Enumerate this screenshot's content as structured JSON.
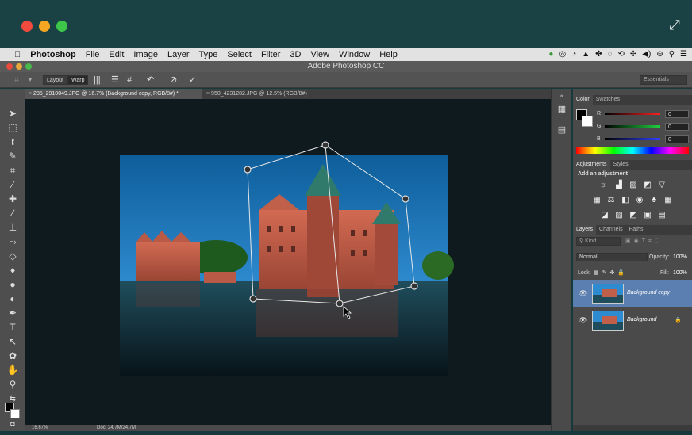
{
  "mac": {
    "app_name": "Photoshop",
    "menus": [
      "File",
      "Edit",
      "Image",
      "Layer",
      "Type",
      "Select",
      "Filter",
      "3D",
      "View",
      "Window",
      "Help"
    ],
    "status_icons": [
      "evernote-icon",
      "creative-cloud-icon",
      "time-icon",
      "bell-icon",
      "puzzle-icon",
      "wifi-icon",
      "history-icon",
      "bluetooth-icon",
      "volume-icon",
      "clock-icon",
      "search-icon",
      "list-icon"
    ]
  },
  "window": {
    "title": "Adobe Photoshop CC"
  },
  "options": {
    "layout_btn": "Layout",
    "warp_btn": "Warp",
    "workspace": "Essentials"
  },
  "tabs": [
    {
      "label": "285_2910049.JPG @ 16.7% (Background copy, RGB/8#) *"
    },
    {
      "label": "950_4231282.JPG @ 12.5% (RGB/8#)"
    }
  ],
  "color_panel": {
    "tabs": [
      "Color",
      "Swatches"
    ],
    "channels": [
      {
        "label": "R",
        "value": "0",
        "color": "#ff2020"
      },
      {
        "label": "G",
        "value": "0",
        "color": "#20d040"
      },
      {
        "label": "B",
        "value": "0",
        "color": "#3040ff"
      }
    ]
  },
  "adjust_panel": {
    "tabs": [
      "Adjustments",
      "Styles"
    ],
    "heading": "Add an adjustment"
  },
  "layers_panel": {
    "tabs": [
      "Layers",
      "Channels",
      "Paths"
    ],
    "filter": "Kind",
    "blend_mode": "Normal",
    "opacity_label": "Opacity:",
    "opacity": "100%",
    "lock_label": "Lock:",
    "fill_label": "Fill:",
    "fill": "100%",
    "layers": [
      {
        "name": "Background copy",
        "selected": true
      },
      {
        "name": "Background",
        "selected": false
      }
    ]
  },
  "status": {
    "zoom": "16.67%",
    "doc": "Doc: 24.7M/24.7M"
  }
}
